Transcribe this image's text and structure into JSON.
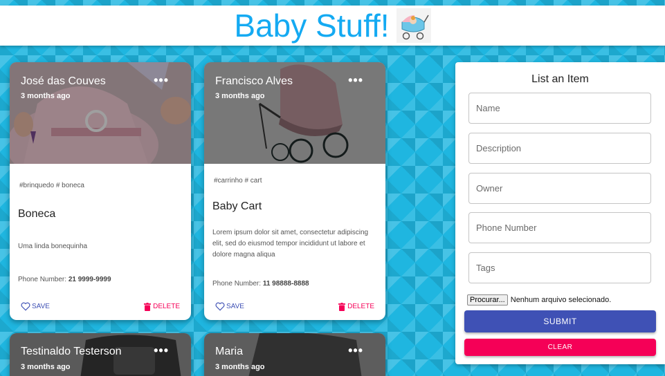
{
  "header": {
    "title": "Baby Stuff!",
    "logo_icon": "stroller-icon"
  },
  "cards": [
    {
      "owner": "José das Couves",
      "date": "3 months ago",
      "more": "•••",
      "tags": "#brinquedo # boneca",
      "name": "Boneca",
      "description": "Uma linda bonequinha",
      "phone_label": "Phone Number:",
      "phone": "21 9999-9999",
      "save_label": "SAVE",
      "delete_label": "DELETE"
    },
    {
      "owner": "Francisco Alves",
      "date": "3 months ago",
      "more": "•••",
      "tags": "#carrinho # cart",
      "name": "Baby Cart",
      "description": "Lorem ipsum dolor sit amet, consectetur adipiscing elit, sed do eiusmod tempor incididunt ut labore et dolore magna aliqua",
      "phone_label": "Phone Number:",
      "phone": "11 98888-8888",
      "save_label": "SAVE",
      "delete_label": "DELETE"
    },
    {
      "owner": "Testinaldo Testerson",
      "date": "3 months ago",
      "more": "•••"
    },
    {
      "owner": "Maria",
      "date": "3 months ago",
      "more": "•••"
    }
  ],
  "form": {
    "title": "List an Item",
    "name_placeholder": "Name",
    "description_placeholder": "Description",
    "owner_placeholder": "Owner",
    "phone_placeholder": "Phone Number",
    "tags_placeholder": "Tags",
    "file_button": "Procurar...",
    "file_status": "Nenhum arquivo selecionado.",
    "submit_label": "SUBMIT",
    "clear_label": "CLEAR"
  },
  "colors": {
    "header_title": "#14aaf2",
    "primary": "#3f51b5",
    "secondary": "#f50057",
    "background": "#1fb6e0"
  }
}
